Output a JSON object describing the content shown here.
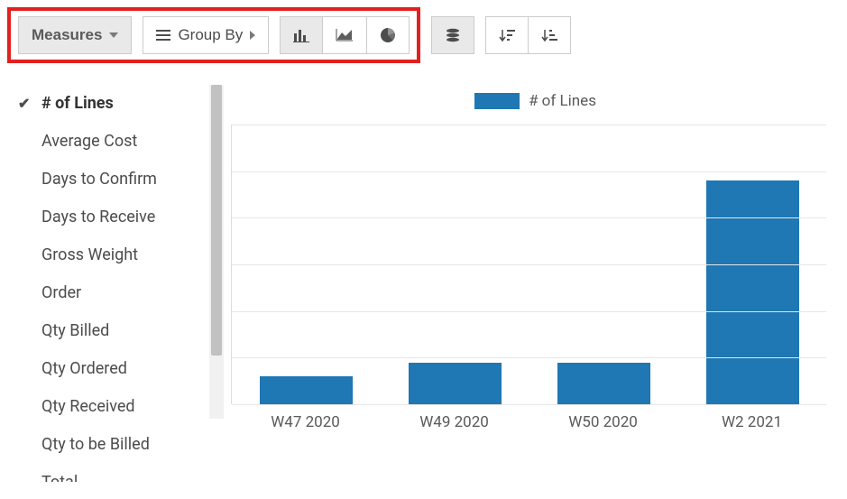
{
  "toolbar": {
    "measures_label": "Measures",
    "groupby_label": "Group By"
  },
  "measures_menu": {
    "items": [
      {
        "label": "# of Lines",
        "selected": true
      },
      {
        "label": "Average Cost",
        "selected": false
      },
      {
        "label": "Days to Confirm",
        "selected": false
      },
      {
        "label": "Days to Receive",
        "selected": false
      },
      {
        "label": "Gross Weight",
        "selected": false
      },
      {
        "label": "Order",
        "selected": false
      },
      {
        "label": "Qty Billed",
        "selected": false
      },
      {
        "label": "Qty Ordered",
        "selected": false
      },
      {
        "label": "Qty Received",
        "selected": false
      },
      {
        "label": "Qty to be Billed",
        "selected": false
      },
      {
        "label": "Total",
        "selected": false
      }
    ]
  },
  "legend": {
    "series_label": "# of Lines"
  },
  "colors": {
    "series": "#1f77b4",
    "highlight": "#e3201f"
  },
  "chart_data": {
    "type": "bar",
    "title": "",
    "xlabel": "",
    "ylabel": "",
    "ylim": [
      0,
      10
    ],
    "categories": [
      "W47 2020",
      "W49 2020",
      "W50 2020",
      "W2 2021"
    ],
    "series": [
      {
        "name": "# of Lines",
        "values": [
          1,
          1.5,
          1.5,
          8
        ]
      }
    ],
    "grid": true,
    "legend_position": "top"
  }
}
